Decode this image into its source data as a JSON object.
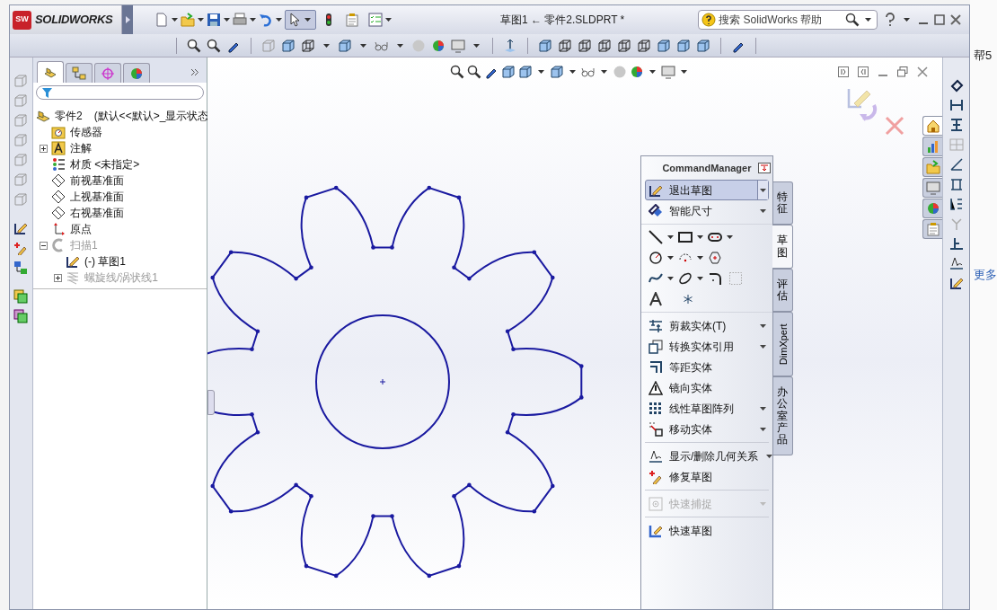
{
  "app": {
    "logo_badge": "SW",
    "logo": "SOLIDWORKS"
  },
  "window": {
    "title": "草图1 ← 零件2.SLDPRT *"
  },
  "search": {
    "placeholder": "搜索 SolidWorks 帮助"
  },
  "feature_manager_tabs": [
    {
      "selected": true
    },
    {
      "selected": false
    },
    {
      "selected": false
    },
    {
      "selected": false
    }
  ],
  "task_pane_tabs": [
    {
      "selected": true
    },
    {
      "selected": false
    },
    {
      "selected": false
    },
    {
      "selected": false
    },
    {
      "selected": false
    },
    {
      "selected": false
    }
  ],
  "feature_tree": {
    "items": [
      {
        "kind": "part",
        "label": "零件2",
        "config": "(默认<<默认>_显示状态",
        "children": [
          {
            "kind": "sensor",
            "label": "传感器"
          },
          {
            "kind": "annotation",
            "label": "注解",
            "expanded": false
          },
          {
            "kind": "material",
            "label": "材质 <未指定>"
          },
          {
            "kind": "plane",
            "label": "前视基准面"
          },
          {
            "kind": "plane",
            "label": "上视基准面"
          },
          {
            "kind": "plane",
            "label": "右视基准面"
          },
          {
            "kind": "origin",
            "label": "原点"
          },
          {
            "kind": "sweep",
            "label": "扫描1",
            "expanded": true,
            "disabled": true,
            "children": [
              {
                "kind": "sketch",
                "label": "(-) 草图1",
                "disabled": false
              },
              {
                "kind": "helix",
                "label": "螺旋线/涡状线1",
                "expanded": false,
                "disabled": true
              }
            ]
          }
        ]
      }
    ]
  },
  "command_manager": {
    "title": "CommandManager",
    "items": [
      {
        "kind": "command",
        "label": "退出草图",
        "dropdown": true,
        "selected": true,
        "disabled": false
      },
      {
        "kind": "command",
        "label": "智能尺寸",
        "dropdown": true,
        "selected": false,
        "disabled": false
      },
      {
        "kind": "sketch-tools"
      },
      {
        "kind": "command",
        "label": "剪裁实体(T)",
        "dropdown": true,
        "selected": false,
        "disabled": false
      },
      {
        "kind": "command",
        "label": "转换实体引用",
        "dropdown": true,
        "selected": false,
        "disabled": false
      },
      {
        "kind": "command",
        "label": "等距实体",
        "dropdown": false,
        "selected": false,
        "disabled": false
      },
      {
        "kind": "command",
        "label": "镜向实体",
        "dropdown": false,
        "selected": false,
        "disabled": false
      },
      {
        "kind": "command",
        "label": "线性草图阵列",
        "dropdown": true,
        "selected": false,
        "disabled": false
      },
      {
        "kind": "command",
        "label": "移动实体",
        "dropdown": true,
        "selected": false,
        "disabled": false
      },
      {
        "kind": "separator"
      },
      {
        "kind": "command",
        "label": "显示/删除几何关系",
        "dropdown": true,
        "selected": false,
        "disabled": false
      },
      {
        "kind": "command",
        "label": "修复草图",
        "dropdown": false,
        "selected": false,
        "disabled": false
      },
      {
        "kind": "separator"
      },
      {
        "kind": "command",
        "label": "快速捕捉",
        "dropdown": true,
        "selected": false,
        "disabled": true
      },
      {
        "kind": "separator"
      },
      {
        "kind": "command",
        "label": "快速草图",
        "dropdown": false,
        "selected": false,
        "disabled": false
      }
    ],
    "tabs": [
      {
        "label": "特征",
        "kind": "cjk",
        "selected": false
      },
      {
        "label": "草图",
        "kind": "cjk",
        "selected": true
      },
      {
        "label": "评估",
        "kind": "cjk",
        "selected": false
      },
      {
        "label": "DimXpert",
        "kind": "latin",
        "selected": false
      },
      {
        "label": "办公室产品",
        "kind": "cjk",
        "selected": false
      }
    ]
  },
  "background_window": {
    "texts": [
      "帮5",
      "更多"
    ]
  }
}
